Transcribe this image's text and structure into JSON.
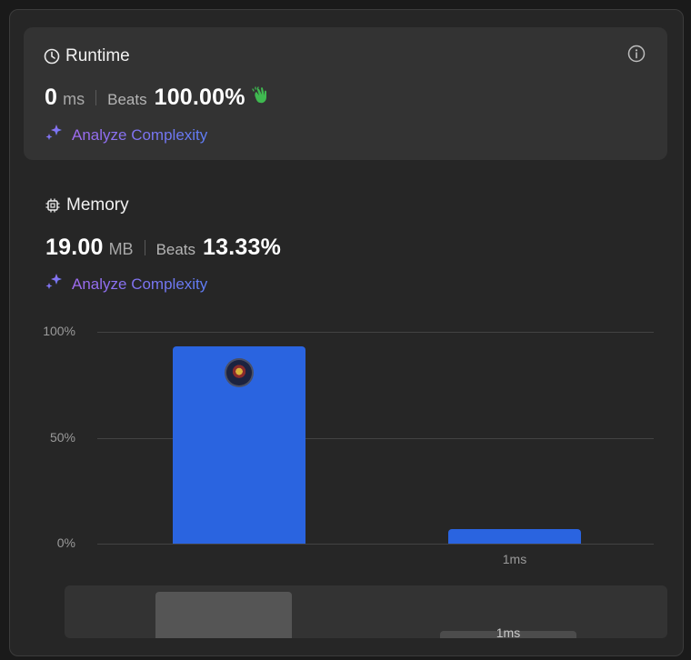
{
  "runtime": {
    "title": "Runtime",
    "value": "0",
    "unit": "ms",
    "beats_label": "Beats",
    "beats_value": "100.00%",
    "analyze_label": "Analyze Complexity"
  },
  "memory": {
    "title": "Memory",
    "value": "19.00",
    "unit": "MB",
    "beats_label": "Beats",
    "beats_value": "13.33%",
    "analyze_label": "Analyze Complexity"
  },
  "colors": {
    "bar": "#2a64e0",
    "accent_gradient_start": "#a06bf0",
    "accent_gradient_end": "#5f7df5",
    "clap": "#3fb950"
  },
  "icons": [
    "clock-icon",
    "info-icon",
    "clap-icon",
    "sparkle-icon",
    "chip-icon",
    "avatar"
  ],
  "chart_data": {
    "type": "bar",
    "categories": [
      "",
      "1ms"
    ],
    "values": [
      93,
      7
    ],
    "yticks": [
      "100%",
      "50%",
      "0%"
    ],
    "ylim": [
      0,
      100
    ],
    "grid": true
  },
  "scrubber": {
    "label": "1ms"
  }
}
